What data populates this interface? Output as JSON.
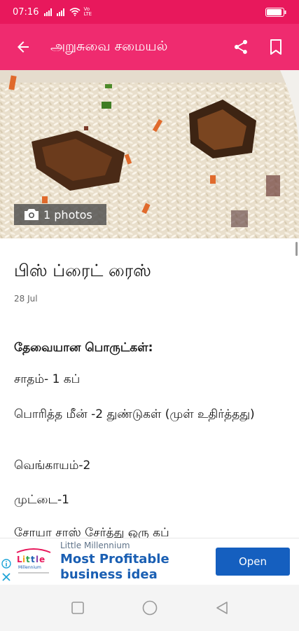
{
  "status_bar": {
    "time": "07:16",
    "network": "Vo LTE"
  },
  "app_bar": {
    "title": "அறுசுவை சமையல்",
    "back_icon": "arrow-back-icon",
    "share_icon": "share-icon",
    "bookmark_icon": "bookmark-icon"
  },
  "hero": {
    "photo_count_label": "1 photos",
    "camera_icon": "camera-icon"
  },
  "article": {
    "title": "பிஸ் ப்ரைட் ரைஸ்",
    "date": "28 Jul",
    "ingredients_heading": "தேவையான பொருட்கள்:",
    "ingredients": [
      "சாதம்- 1 கப்",
      "பொரித்த மீன் -2 துண்டுகள் (முள் உதிர்த்தது)",
      "வெங்காயம்-2",
      "முட்டை-1",
      "சோயா சாஸ் சேர்த்து ஒரு கப்"
    ]
  },
  "ad": {
    "brand": "Little Millennium",
    "headline": "Most Profitable business idea",
    "button_label": "Open",
    "logo_text": "Little Millennium"
  },
  "colors": {
    "status_bar": "#e8185c",
    "app_bar": "#ef2b6f",
    "ad_button": "#155fbf"
  }
}
